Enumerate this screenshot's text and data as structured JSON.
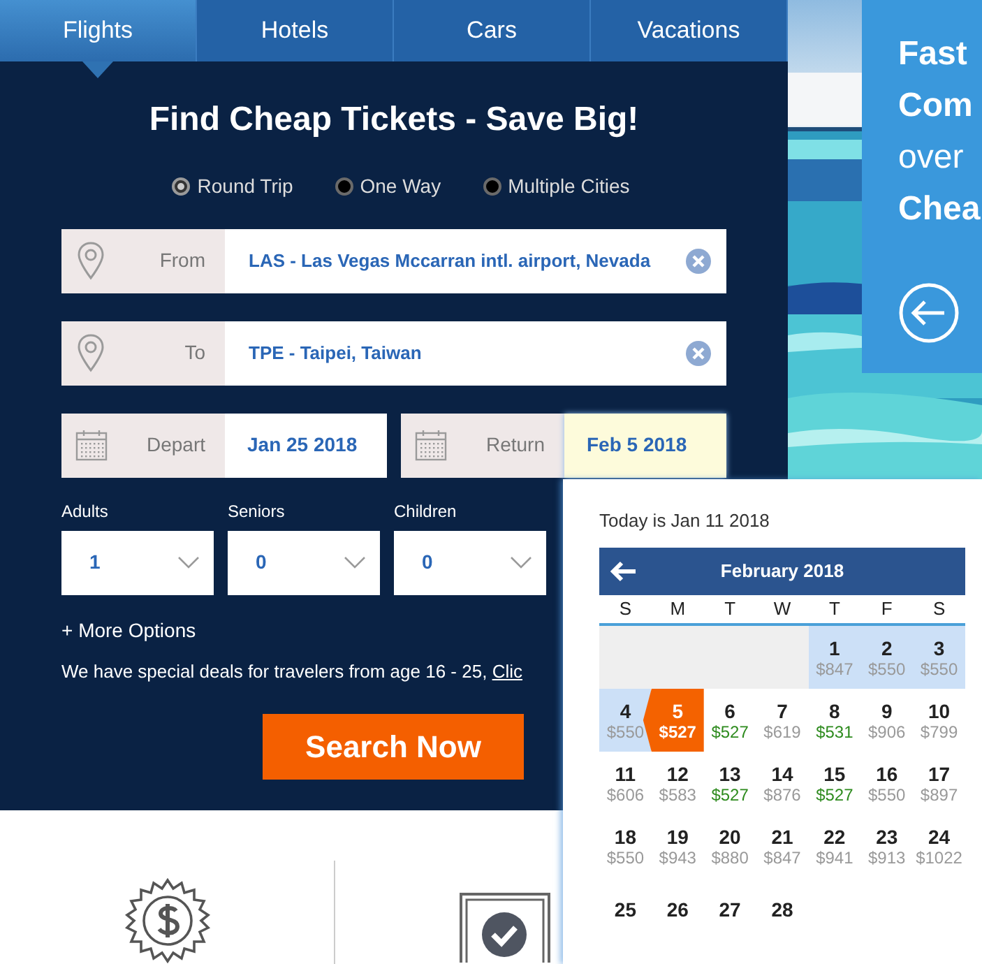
{
  "tabs": [
    {
      "label": "Flights",
      "selected": true
    },
    {
      "label": "Hotels",
      "selected": false
    },
    {
      "label": "Cars",
      "selected": false
    },
    {
      "label": "Vacations",
      "selected": false
    }
  ],
  "search_form": {
    "title": "Find Cheap Tickets - Save Big!",
    "trip_types": [
      {
        "label": "Round Trip",
        "selected": true
      },
      {
        "label": "One Way",
        "selected": false
      },
      {
        "label": "Multiple Cities",
        "selected": false
      }
    ],
    "from": {
      "label": "From",
      "value": "LAS - Las Vegas Mccarran intl. airport, Nevada"
    },
    "to": {
      "label": "To",
      "value": "TPE - Taipei, Taiwan"
    },
    "depart": {
      "label": "Depart",
      "value": "Jan 25 2018",
      "focused": false
    },
    "return": {
      "label": "Return",
      "value": "Feb 5 2018",
      "focused": true
    },
    "passengers": [
      {
        "label": "Adults",
        "value": "1"
      },
      {
        "label": "Seniors",
        "value": "0"
      },
      {
        "label": "Children",
        "value": "0"
      }
    ],
    "more_options": "+ More Options",
    "deals_text": "We have special deals for travelers from age 16 - 25,",
    "deals_link": "Clic",
    "search_button": "Search Now"
  },
  "promo": {
    "lines": [
      {
        "text": "Fast",
        "bold": true
      },
      {
        "text": "Com",
        "bold": true
      },
      {
        "text": "over",
        "bold": false
      },
      {
        "text": "Chea",
        "bold": true
      }
    ]
  },
  "calendar": {
    "today": "Today is Jan 11 2018",
    "month": "February 2018",
    "weekdays": [
      "S",
      "M",
      "T",
      "W",
      "T",
      "F",
      "S"
    ],
    "weeks": [
      [
        {
          "kind": "blank"
        },
        {
          "kind": "blank"
        },
        {
          "kind": "blank"
        },
        {
          "kind": "blank"
        },
        {
          "kind": "day",
          "day": "1",
          "price": "$847",
          "color": "#999999",
          "in_range": true,
          "selected": false
        },
        {
          "kind": "day",
          "day": "2",
          "price": "$550",
          "color": "#999999",
          "in_range": true,
          "selected": false
        },
        {
          "kind": "day",
          "day": "3",
          "price": "$550",
          "color": "#999999",
          "in_range": true,
          "selected": false
        }
      ],
      [
        {
          "kind": "day",
          "day": "4",
          "price": "$550",
          "color": "#999999",
          "in_range": true,
          "selected": false
        },
        {
          "kind": "day",
          "day": "5",
          "price": "$527",
          "in_range": false,
          "selected": true
        },
        {
          "kind": "day",
          "day": "6",
          "price": "$527",
          "color": "#2e8b1e",
          "in_range": false,
          "selected": false
        },
        {
          "kind": "day",
          "day": "7",
          "price": "$619",
          "color": "#999999",
          "in_range": false,
          "selected": false
        },
        {
          "kind": "day",
          "day": "8",
          "price": "$531",
          "color": "#2e8b1e",
          "in_range": false,
          "selected": false
        },
        {
          "kind": "day",
          "day": "9",
          "price": "$906",
          "color": "#999999",
          "in_range": false,
          "selected": false
        },
        {
          "kind": "day",
          "day": "10",
          "price": "$799",
          "color": "#999999",
          "in_range": false,
          "selected": false
        }
      ],
      [
        {
          "kind": "day",
          "day": "11",
          "price": "$606",
          "color": "#999999",
          "in_range": false,
          "selected": false
        },
        {
          "kind": "day",
          "day": "12",
          "price": "$583",
          "color": "#999999",
          "in_range": false,
          "selected": false
        },
        {
          "kind": "day",
          "day": "13",
          "price": "$527",
          "color": "#2e8b1e",
          "in_range": false,
          "selected": false
        },
        {
          "kind": "day",
          "day": "14",
          "price": "$876",
          "color": "#999999",
          "in_range": false,
          "selected": false
        },
        {
          "kind": "day",
          "day": "15",
          "price": "$527",
          "color": "#2e8b1e",
          "in_range": false,
          "selected": false
        },
        {
          "kind": "day",
          "day": "16",
          "price": "$550",
          "color": "#999999",
          "in_range": false,
          "selected": false
        },
        {
          "kind": "day",
          "day": "17",
          "price": "$897",
          "color": "#999999",
          "in_range": false,
          "selected": false
        }
      ],
      [
        {
          "kind": "day",
          "day": "18",
          "price": "$550",
          "color": "#999999",
          "in_range": false,
          "selected": false
        },
        {
          "kind": "day",
          "day": "19",
          "price": "$943",
          "color": "#999999",
          "in_range": false,
          "selected": false
        },
        {
          "kind": "day",
          "day": "20",
          "price": "$880",
          "color": "#999999",
          "in_range": false,
          "selected": false
        },
        {
          "kind": "day",
          "day": "21",
          "price": "$847",
          "color": "#999999",
          "in_range": false,
          "selected": false
        },
        {
          "kind": "day",
          "day": "22",
          "price": "$941",
          "color": "#999999",
          "in_range": false,
          "selected": false
        },
        {
          "kind": "day",
          "day": "23",
          "price": "$913",
          "color": "#999999",
          "in_range": false,
          "selected": false
        },
        {
          "kind": "day",
          "day": "24",
          "price": "$1022",
          "color": "#999999",
          "in_range": false,
          "selected": false
        }
      ],
      [
        {
          "kind": "day",
          "day": "25",
          "in_range": false,
          "selected": false
        },
        {
          "kind": "day",
          "day": "26",
          "in_range": false,
          "selected": false
        },
        {
          "kind": "day",
          "day": "27",
          "in_range": false,
          "selected": false
        },
        {
          "kind": "day",
          "day": "28",
          "in_range": false,
          "selected": false
        }
      ]
    ]
  }
}
